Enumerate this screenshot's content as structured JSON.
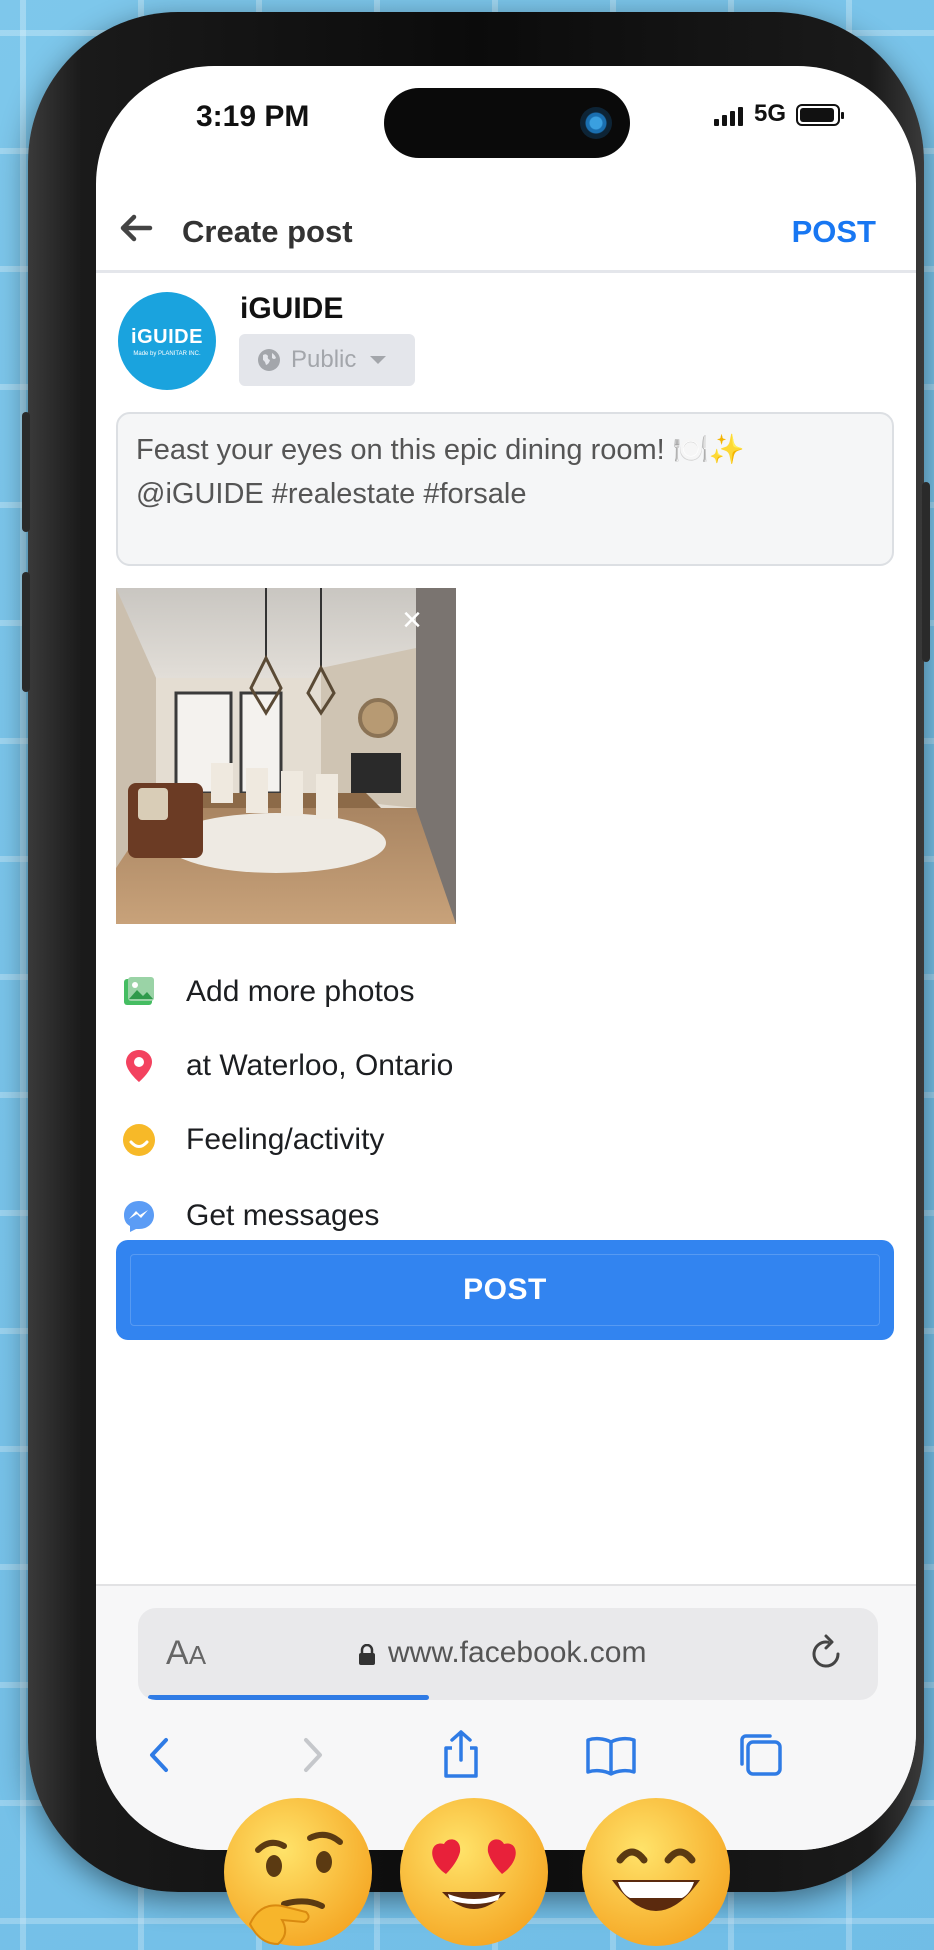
{
  "status_bar": {
    "time": "3:19 PM",
    "network": "5G"
  },
  "header": {
    "title": "Create post",
    "post_label": "POST"
  },
  "page": {
    "name": "iGUIDE",
    "avatar_logo": "iGUIDE",
    "avatar_sub": "Made by PLANITAR INC.",
    "privacy": "Public"
  },
  "composer": {
    "line1": "Feast your eyes on this epic dining room! 🍽️✨",
    "line2": "@iGUIDE  #realestate #forsale"
  },
  "photo": {
    "close_label": "×"
  },
  "options": [
    {
      "label": "Add more photos",
      "icon": "photo-icon"
    },
    {
      "label": "at Waterloo, Ontario",
      "icon": "location-pin-icon"
    },
    {
      "label": "Feeling/activity",
      "icon": "smiley-icon"
    },
    {
      "label": "Get messages",
      "icon": "messenger-icon"
    }
  ],
  "post_button": {
    "label": "POST"
  },
  "browser": {
    "text_size_label": "A",
    "text_size_small": "A",
    "url": "www.facebook.com",
    "load_progress": 0.38
  },
  "colors": {
    "accent": "#1877f2",
    "button": "#3284f0",
    "avatar": "#1aa3de"
  }
}
